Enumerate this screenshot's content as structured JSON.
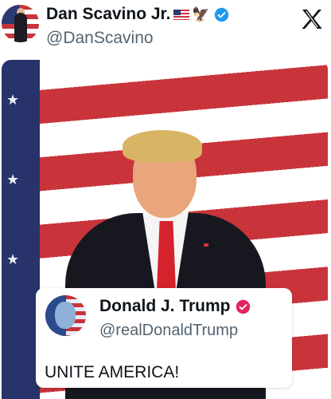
{
  "author": {
    "name": "Dan Scavino Jr.",
    "handle": "@DanScavino",
    "name_emojis": [
      "us-flag-icon",
      "eagle-icon"
    ],
    "verified_color": "#1d9bf0"
  },
  "platform": {
    "logo": "x-logo-icon"
  },
  "media": {
    "description_icon": "photo"
  },
  "quoted": {
    "name": "Donald J. Trump",
    "handle": "@realDonaldTrump",
    "verified_color": "#e0245e",
    "text": "UNITE AMERICA!"
  },
  "colors": {
    "text_primary": "#0f1419",
    "text_secondary": "#536471"
  }
}
